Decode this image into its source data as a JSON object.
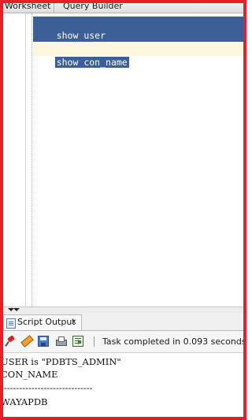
{
  "tabs": {
    "worksheet": "Worksheet",
    "query_builder": "Query Builder"
  },
  "editor": {
    "lines": [
      "show user",
      "show con_name"
    ]
  },
  "output_panel": {
    "tab_label": "Script Output",
    "close_label": "x",
    "status": "Task completed in 0.093 seconds",
    "lines": [
      "USER is \"PDBTS_ADMIN\"",
      "CON_NAME",
      "------------------------------",
      "WAYAPDB"
    ]
  },
  "toolbar_icons": [
    "pin-icon",
    "clear-icon",
    "save-icon",
    "print-icon",
    "run-script-icon"
  ],
  "colors": {
    "selection": "#3b5f96",
    "current_line": "#fdf7dd",
    "frame": "#e5202a"
  }
}
